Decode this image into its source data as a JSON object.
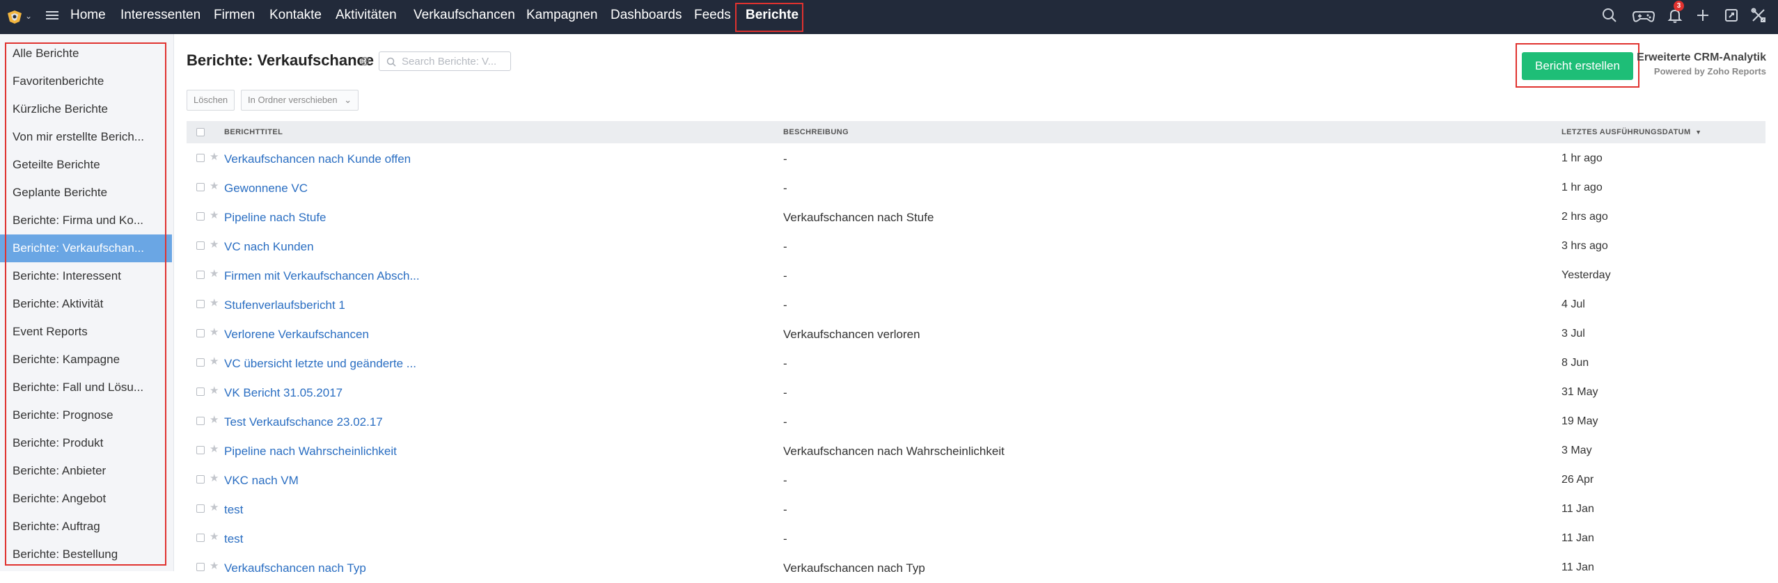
{
  "nav": {
    "items": [
      "Home",
      "Interessenten",
      "Firmen",
      "Kontakte",
      "Aktivitäten",
      "Verkaufschancen",
      "Kampagnen",
      "Dashboards",
      "Feeds",
      "Berichte"
    ],
    "active": "Berichte",
    "notification_count": "3",
    "icons": [
      "search-icon",
      "gamepad-icon",
      "bell-icon",
      "plus-icon",
      "compose-icon",
      "tools-icon"
    ]
  },
  "sidebar": {
    "items": [
      "Alle Berichte",
      "Favoritenberichte",
      "Kürzliche Berichte",
      "Von mir erstellte Berich...",
      "Geteilte Berichte",
      "Geplante Berichte",
      "Berichte: Firma und Ko...",
      "Berichte: Verkaufschan...",
      "Berichte: Interessent",
      "Berichte: Aktivität",
      "Event Reports",
      "Berichte: Kampagne",
      "Berichte: Fall und Lösu...",
      "Berichte: Prognose",
      "Berichte: Produkt",
      "Berichte: Anbieter",
      "Berichte: Angebot",
      "Berichte: Auftrag",
      "Berichte: Bestellung"
    ],
    "active_index": 7
  },
  "header": {
    "title": "Berichte: Verkaufschance",
    "search_placeholder": "Search Berichte: V...",
    "create_label": "Bericht erstellen",
    "crm_title": "Erweiterte CRM-Analytik",
    "crm_sub": "Powered by Zoho Reports"
  },
  "actions": {
    "delete_label": "Löschen",
    "move_label": "In Ordner verschieben"
  },
  "table": {
    "columns": [
      "BERICHTTITEL",
      "BESCHREIBUNG",
      "LETZTES AUSFÜHRUNGSDATUM"
    ],
    "rows": [
      {
        "title": "Verkaufschancen nach Kunde offen",
        "desc": "-",
        "date": "1 hr ago"
      },
      {
        "title": "Gewonnene VC",
        "desc": "-",
        "date": "1 hr ago"
      },
      {
        "title": "Pipeline nach Stufe",
        "desc": "Verkaufschancen nach Stufe",
        "date": "2 hrs ago"
      },
      {
        "title": "VC nach Kunden",
        "desc": "-",
        "date": "3 hrs ago"
      },
      {
        "title": "Firmen mit Verkaufschancen Absch...",
        "desc": "-",
        "date": "Yesterday"
      },
      {
        "title": "Stufenverlaufsbericht 1",
        "desc": "-",
        "date": "4 Jul"
      },
      {
        "title": "Verlorene Verkaufschancen",
        "desc": "Verkaufschancen verloren",
        "date": "3 Jul"
      },
      {
        "title": "VC übersicht letzte und geänderte ...",
        "desc": "-",
        "date": "8 Jun"
      },
      {
        "title": "VK Bericht 31.05.2017",
        "desc": "-",
        "date": "31 May"
      },
      {
        "title": "Test Verkaufschance 23.02.17",
        "desc": "-",
        "date": "19 May"
      },
      {
        "title": "Pipeline nach Wahrscheinlichkeit",
        "desc": "Verkaufschancen nach Wahrscheinlichkeit",
        "date": "3 May"
      },
      {
        "title": "VKC nach VM",
        "desc": "-",
        "date": "26 Apr"
      },
      {
        "title": "test",
        "desc": "-",
        "date": "11 Jan"
      },
      {
        "title": "test",
        "desc": "-",
        "date": "11 Jan"
      },
      {
        "title": "Verkaufschancen nach Typ",
        "desc": "Verkaufschancen nach Typ",
        "date": "11 Jan"
      }
    ]
  }
}
